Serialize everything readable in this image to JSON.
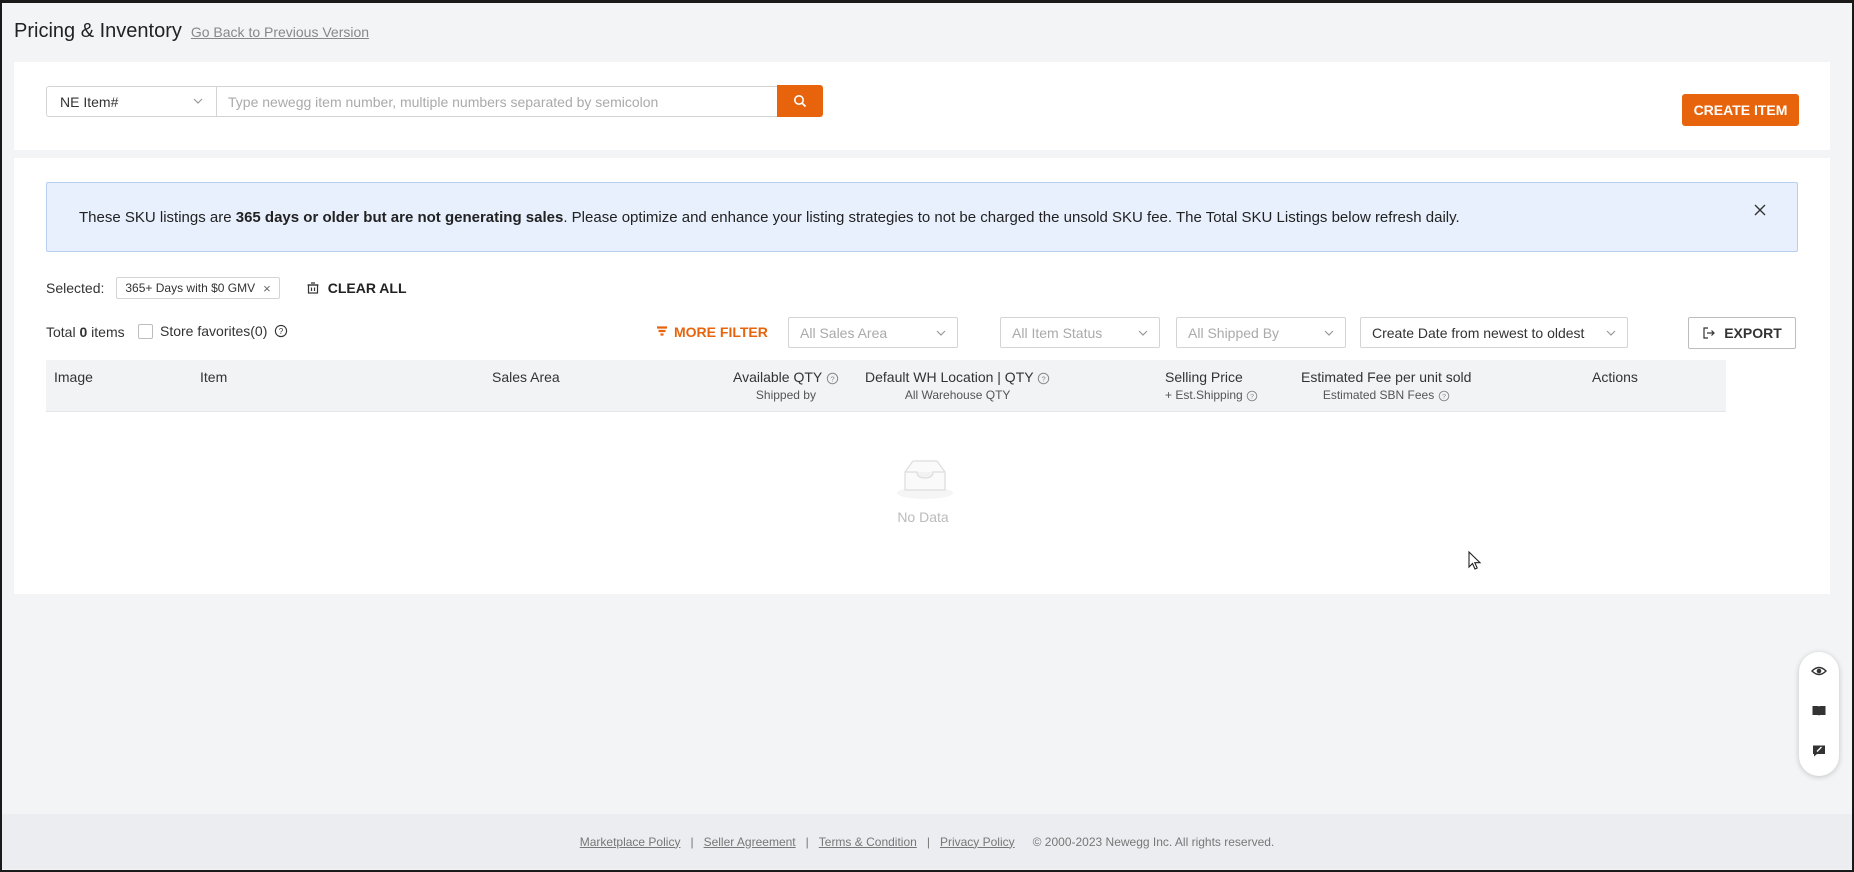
{
  "header": {
    "title": "Pricing & Inventory",
    "back_link": "Go Back to Previous Version"
  },
  "search": {
    "type_value": "NE Item#",
    "placeholder": "Type newegg item number, multiple numbers separated by semicolon",
    "create_label": "CREATE ITEM"
  },
  "notice": {
    "text_before": "These SKU listings are ",
    "text_bold": "365 days or older but are not generating sales",
    "text_after": ". Please optimize and enhance your listing strategies to not be charged the unsold SKU fee. The Total SKU Listings below refresh daily."
  },
  "selected": {
    "label": "Selected:",
    "tag": "365+ Days with $0 GMV",
    "clear_all": "CLEAR ALL"
  },
  "toolbar": {
    "total_prefix": "Total ",
    "total_count": "0",
    "total_suffix": " items",
    "store_favorites": "Store favorites(0)",
    "more_filter": "MORE FILTER",
    "sales_area_placeholder": "All Sales Area",
    "item_status_placeholder": "All Item Status",
    "shipped_by_placeholder": "All Shipped By",
    "sort_value": "Create Date from newest to oldest",
    "export_label": "EXPORT"
  },
  "table": {
    "columns": [
      {
        "label": "Image",
        "sub": ""
      },
      {
        "label": "Item",
        "sub": ""
      },
      {
        "label": "Sales Area",
        "sub": ""
      },
      {
        "label": "Available QTY",
        "sub": "Shipped by"
      },
      {
        "label": "Default WH Location | QTY",
        "sub": "All Warehouse QTY"
      },
      {
        "label": "Selling Price",
        "sub": "+ Est.Shipping"
      },
      {
        "label": "Estimated Fee per unit sold",
        "sub": "Estimated SBN Fees"
      },
      {
        "label": "Actions",
        "sub": ""
      }
    ],
    "empty_text": "No Data"
  },
  "footer": {
    "links": [
      "Marketplace Policy",
      "Seller Agreement",
      "Terms & Condition",
      "Privacy Policy"
    ],
    "separator": "|",
    "copyright": "© 2000-2023 Newegg Inc. All rights reserved."
  },
  "colors": {
    "accent": "#e8640c",
    "notice_bg": "#e8f0fd"
  },
  "icons": {
    "float_bar": [
      "eye-icon",
      "book-icon",
      "feedback-icon"
    ]
  }
}
